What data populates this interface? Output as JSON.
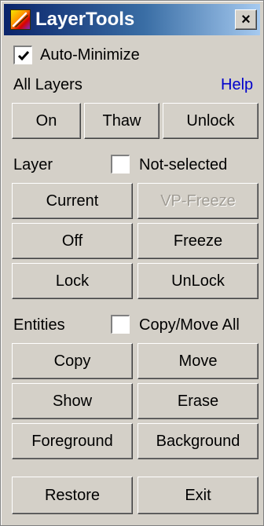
{
  "window": {
    "title": "LayerTools",
    "close_label": "×"
  },
  "auto_minimize": {
    "label": "Auto-Minimize",
    "checked": true
  },
  "all_layers": {
    "heading": "All Layers",
    "help_link": "Help",
    "buttons": {
      "on": "On",
      "thaw": "Thaw",
      "unlock": "Unlock"
    }
  },
  "layer": {
    "heading": "Layer",
    "not_selected": {
      "label": "Not-selected",
      "checked": false
    },
    "buttons": {
      "current": "Current",
      "vp_freeze": "VP-Freeze",
      "off": "Off",
      "freeze": "Freeze",
      "lock": "Lock",
      "unlock": "UnLock"
    }
  },
  "entities": {
    "heading": "Entities",
    "copy_move_all": {
      "label": "Copy/Move All",
      "checked": false
    },
    "buttons": {
      "copy": "Copy",
      "move": "Move",
      "show": "Show",
      "erase": "Erase",
      "foreground": "Foreground",
      "background": "Background"
    }
  },
  "footer": {
    "restore": "Restore",
    "exit": "Exit"
  },
  "colors": {
    "face": "#d4d0c8",
    "title_start": "#0a246a",
    "title_end": "#a6caf0",
    "link": "#0000cc",
    "disabled_text": "#a09c94"
  },
  "icons": {
    "app": "layer-tools-app-icon",
    "checkmark": "checkmark-icon",
    "close": "close-icon"
  }
}
